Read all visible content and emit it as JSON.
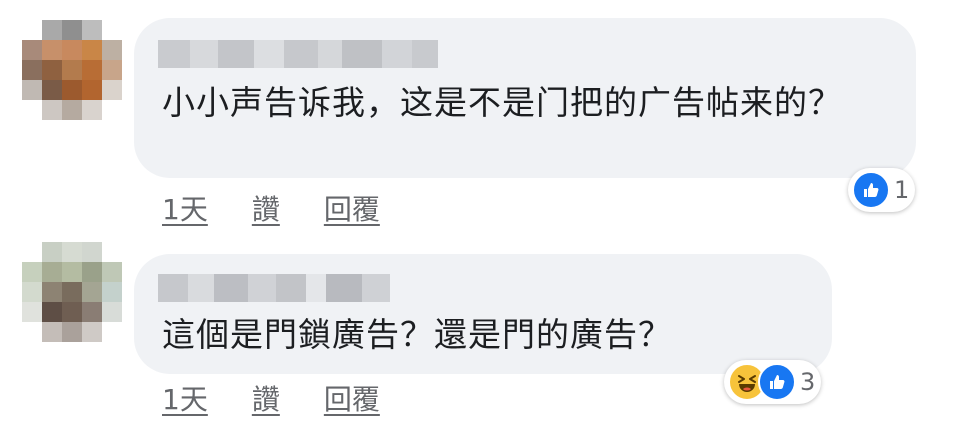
{
  "comments": [
    {
      "text": "小小声告诉我，这是不是门把的广告帖来的？",
      "time": "1天",
      "like_label": "讚",
      "reply_label": "回覆",
      "reaction_count": "1",
      "reactions": [
        "like-icon"
      ]
    },
    {
      "text": "這個是門鎖廣告？還是門的廣告？",
      "time": "1天",
      "like_label": "讚",
      "reply_label": "回覆",
      "reaction_count": "3",
      "reactions": [
        "haha-icon",
        "like-icon"
      ]
    }
  ],
  "colors": {
    "bubble": "#f0f2f5",
    "text": "#1c1e21",
    "meta": "#65676b",
    "like": "#1877f2",
    "haha": "#f7c33b"
  }
}
